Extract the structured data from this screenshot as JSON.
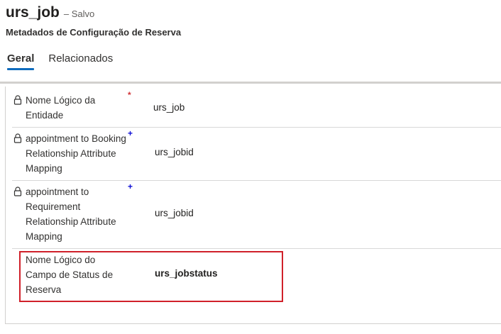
{
  "header": {
    "title": "urs_job",
    "save_status": "– Salvo",
    "entity": "Metadados de Configuração de Reserva"
  },
  "tabs": [
    {
      "label": "Geral",
      "active": true
    },
    {
      "label": "Relacionados",
      "active": false
    }
  ],
  "fields": [
    {
      "label": "Nome Lógico da Entidade",
      "value": "urs_job",
      "locked": true,
      "required": "required"
    },
    {
      "label": "appointment to Booking Relationship Attribute Mapping",
      "value": "urs_jobid",
      "locked": true,
      "required": "recommended"
    },
    {
      "label": "appointment to Requirement Relationship Attribute Mapping",
      "value": "urs_jobid",
      "locked": true,
      "required": "recommended"
    },
    {
      "label": "Nome Lógico do Campo de Status de Reserva",
      "value": "urs_jobstatus",
      "locked": false,
      "required": "none",
      "highlighted": true
    }
  ],
  "colors": {
    "accent": "#0f6cbd",
    "required_marker": "#d13438",
    "recommended_marker": "#0f0fd6",
    "highlight": "#d0202a"
  }
}
